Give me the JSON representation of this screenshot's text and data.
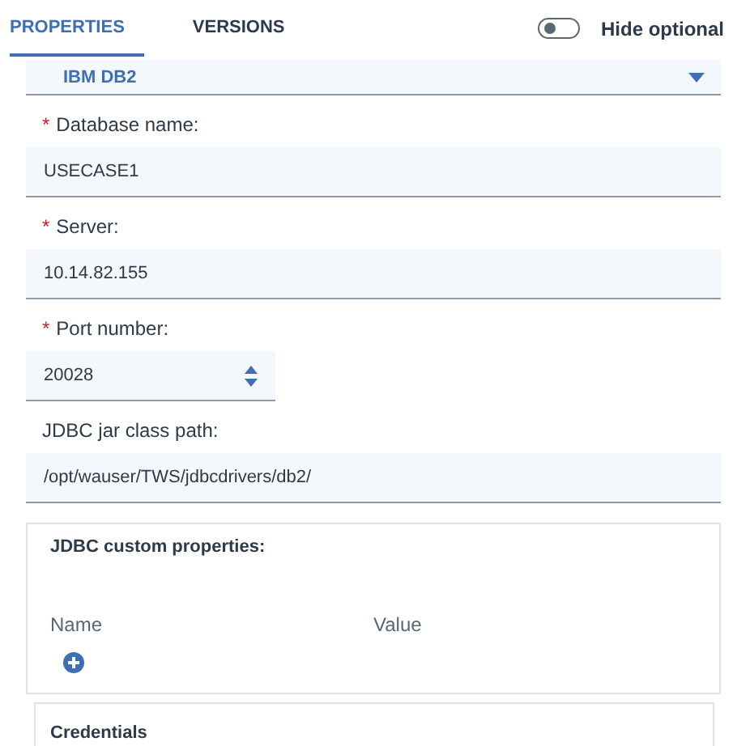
{
  "tabs": [
    {
      "label": "PROPERTIES",
      "selected": true
    },
    {
      "label": "VERSIONS",
      "selected": false
    }
  ],
  "hide_optional": {
    "label": "Hide optional",
    "on": false
  },
  "dropdown": {
    "value": "IBM DB2"
  },
  "fields": [
    {
      "required_mark": "*",
      "label": "Database name:",
      "value": "USECASE1",
      "kind": "text"
    },
    {
      "required_mark": "*",
      "label": "Server:",
      "value": "10.14.82.155",
      "kind": "text"
    },
    {
      "required_mark": "*",
      "label": "Port number:",
      "value": "20028",
      "kind": "number"
    },
    {
      "label": "JDBC jar class path:",
      "value": "/opt/wauser/TWS/jdbcdrivers/db2/",
      "kind": "text"
    }
  ],
  "custom_properties": {
    "title": "JDBC custom properties:",
    "columns": [
      "Name",
      "Value"
    ]
  },
  "credentials": {
    "title": "Credentials"
  }
}
